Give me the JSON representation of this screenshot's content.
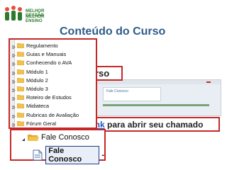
{
  "brand": {
    "line1": "MELHOR GESTÃO",
    "line2": "MELHOR ENSINO"
  },
  "title": "Conteúdo do Curso",
  "menu_items": [
    {
      "label": "Regulamento"
    },
    {
      "label": "Guias e Manuais"
    },
    {
      "label": "Conhecendo o AVA"
    },
    {
      "label": "Módulo 1"
    },
    {
      "label": "Módulo 2"
    },
    {
      "label": "Módulo 3"
    },
    {
      "label": "Roteiro de Estudos"
    },
    {
      "label": "Midiateca"
    },
    {
      "label": "Rubricas de Avaliação"
    },
    {
      "label": "Fórum Geral"
    }
  ],
  "callout_curso": "urso",
  "callout_link": {
    "link": "link",
    "rest": " para abrir seu chamado"
  },
  "background_card": "Fale Conosco",
  "zoom": {
    "folder_label": "Fale Conosco",
    "page_label": "Fale Conosco",
    "dash": "-"
  },
  "colors": {
    "title": "#2f5c8a",
    "border": "#c62828",
    "folder": "#f2c14e",
    "brand": "#2d7a2d"
  }
}
